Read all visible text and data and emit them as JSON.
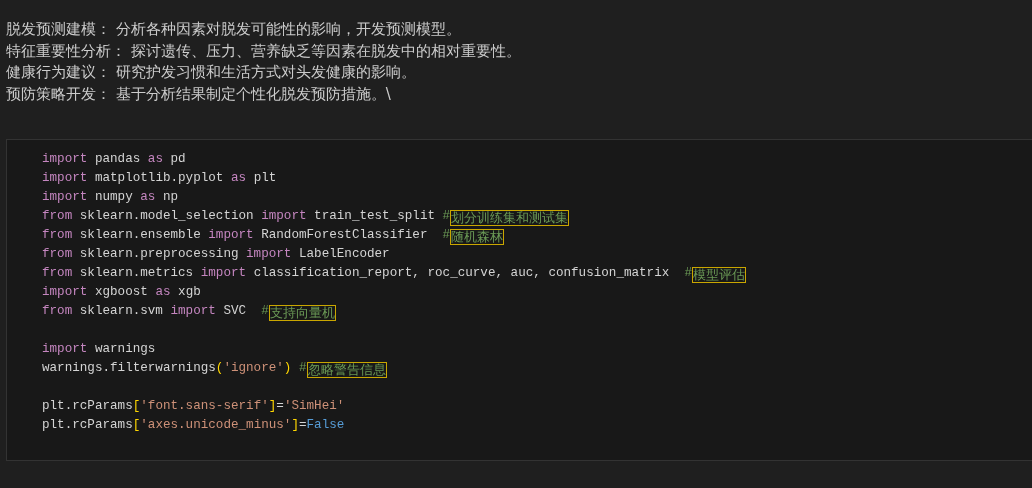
{
  "markdown": {
    "lines": [
      "脱发预测建模： 分析各种因素对脱发可能性的影响，开发预测模型。",
      "特征重要性分析： 探讨遗传、压力、营养缺乏等因素在脱发中的相对重要性。",
      "健康行为建议： 研究护发习惯和生活方式对头发健康的影响。",
      "预防策略开发： 基于分析结果制定个性化脱发预防措施。\\"
    ]
  },
  "code_cell": {
    "lines": [
      {
        "kind": "code",
        "tokens": [
          {
            "text": "import",
            "kind": "keyword"
          },
          {
            "text": " pandas ",
            "kind": "plain"
          },
          {
            "text": "as",
            "kind": "keyword"
          },
          {
            "text": " pd",
            "kind": "plain"
          }
        ]
      },
      {
        "kind": "code",
        "tokens": [
          {
            "text": "import",
            "kind": "keyword"
          },
          {
            "text": " matplotlib.pyplot ",
            "kind": "plain"
          },
          {
            "text": "as",
            "kind": "keyword"
          },
          {
            "text": " plt",
            "kind": "plain"
          }
        ]
      },
      {
        "kind": "code",
        "tokens": [
          {
            "text": "import",
            "kind": "keyword"
          },
          {
            "text": " numpy ",
            "kind": "plain"
          },
          {
            "text": "as",
            "kind": "keyword"
          },
          {
            "text": " np",
            "kind": "plain"
          }
        ]
      },
      {
        "kind": "code",
        "tokens": [
          {
            "text": "from",
            "kind": "keyword"
          },
          {
            "text": " sklearn.model_selection ",
            "kind": "plain"
          },
          {
            "text": "import",
            "kind": "keyword"
          },
          {
            "text": " train_test_split ",
            "kind": "plain"
          },
          {
            "text": "#",
            "kind": "comment"
          },
          {
            "text": "划分训练集和测试集",
            "kind": "comment",
            "highlighted": true
          }
        ]
      },
      {
        "kind": "code",
        "tokens": [
          {
            "text": "from",
            "kind": "keyword"
          },
          {
            "text": " sklearn.ensemble ",
            "kind": "plain"
          },
          {
            "text": "import",
            "kind": "keyword"
          },
          {
            "text": " RandomForestClassifier  ",
            "kind": "plain"
          },
          {
            "text": "#",
            "kind": "comment"
          },
          {
            "text": "随机森林",
            "kind": "comment",
            "highlighted": true
          }
        ]
      },
      {
        "kind": "code",
        "tokens": [
          {
            "text": "from",
            "kind": "keyword"
          },
          {
            "text": " sklearn.preprocessing ",
            "kind": "plain"
          },
          {
            "text": "import",
            "kind": "keyword"
          },
          {
            "text": " LabelEncoder",
            "kind": "plain"
          }
        ]
      },
      {
        "kind": "code",
        "tokens": [
          {
            "text": "from",
            "kind": "keyword"
          },
          {
            "text": " sklearn.metrics ",
            "kind": "plain"
          },
          {
            "text": "import",
            "kind": "keyword"
          },
          {
            "text": " classification_report, roc_curve, auc, confusion_matrix  ",
            "kind": "plain"
          },
          {
            "text": "#",
            "kind": "comment"
          },
          {
            "text": "模型评估",
            "kind": "comment",
            "highlighted": true
          }
        ]
      },
      {
        "kind": "code",
        "tokens": [
          {
            "text": "import",
            "kind": "keyword"
          },
          {
            "text": " xgboost ",
            "kind": "plain"
          },
          {
            "text": "as",
            "kind": "keyword"
          },
          {
            "text": " xgb",
            "kind": "plain"
          }
        ]
      },
      {
        "kind": "code",
        "tokens": [
          {
            "text": "from",
            "kind": "keyword"
          },
          {
            "text": " sklearn.svm ",
            "kind": "plain"
          },
          {
            "text": "import",
            "kind": "keyword"
          },
          {
            "text": " SVC  ",
            "kind": "plain"
          },
          {
            "text": "#",
            "kind": "comment"
          },
          {
            "text": "支持向量机",
            "kind": "comment",
            "highlighted": true
          }
        ]
      },
      {
        "kind": "blank"
      },
      {
        "kind": "code",
        "tokens": [
          {
            "text": "import",
            "kind": "keyword"
          },
          {
            "text": " warnings",
            "kind": "plain"
          }
        ]
      },
      {
        "kind": "code",
        "tokens": [
          {
            "text": "warnings.filterwarnings",
            "kind": "plain"
          },
          {
            "text": "(",
            "kind": "bracket"
          },
          {
            "text": "'ignore'",
            "kind": "string"
          },
          {
            "text": ") ",
            "kind": "bracket"
          },
          {
            "text": "#",
            "kind": "comment"
          },
          {
            "text": "忽略警告信息",
            "kind": "comment",
            "highlighted": true
          }
        ]
      },
      {
        "kind": "blank"
      },
      {
        "kind": "code",
        "tokens": [
          {
            "text": "plt.rcParams",
            "kind": "plain"
          },
          {
            "text": "[",
            "kind": "bracket"
          },
          {
            "text": "'font.sans-serif'",
            "kind": "string"
          },
          {
            "text": "]",
            "kind": "bracket"
          },
          {
            "text": "=",
            "kind": "plain"
          },
          {
            "text": "'SimHei'",
            "kind": "string"
          }
        ]
      },
      {
        "kind": "code",
        "tokens": [
          {
            "text": "plt.rcParams",
            "kind": "plain"
          },
          {
            "text": "[",
            "kind": "bracket"
          },
          {
            "text": "'axes.unicode_minus'",
            "kind": "string"
          },
          {
            "text": "]",
            "kind": "bracket"
          },
          {
            "text": "=",
            "kind": "plain"
          },
          {
            "text": "False",
            "kind": "constant"
          }
        ]
      }
    ]
  }
}
